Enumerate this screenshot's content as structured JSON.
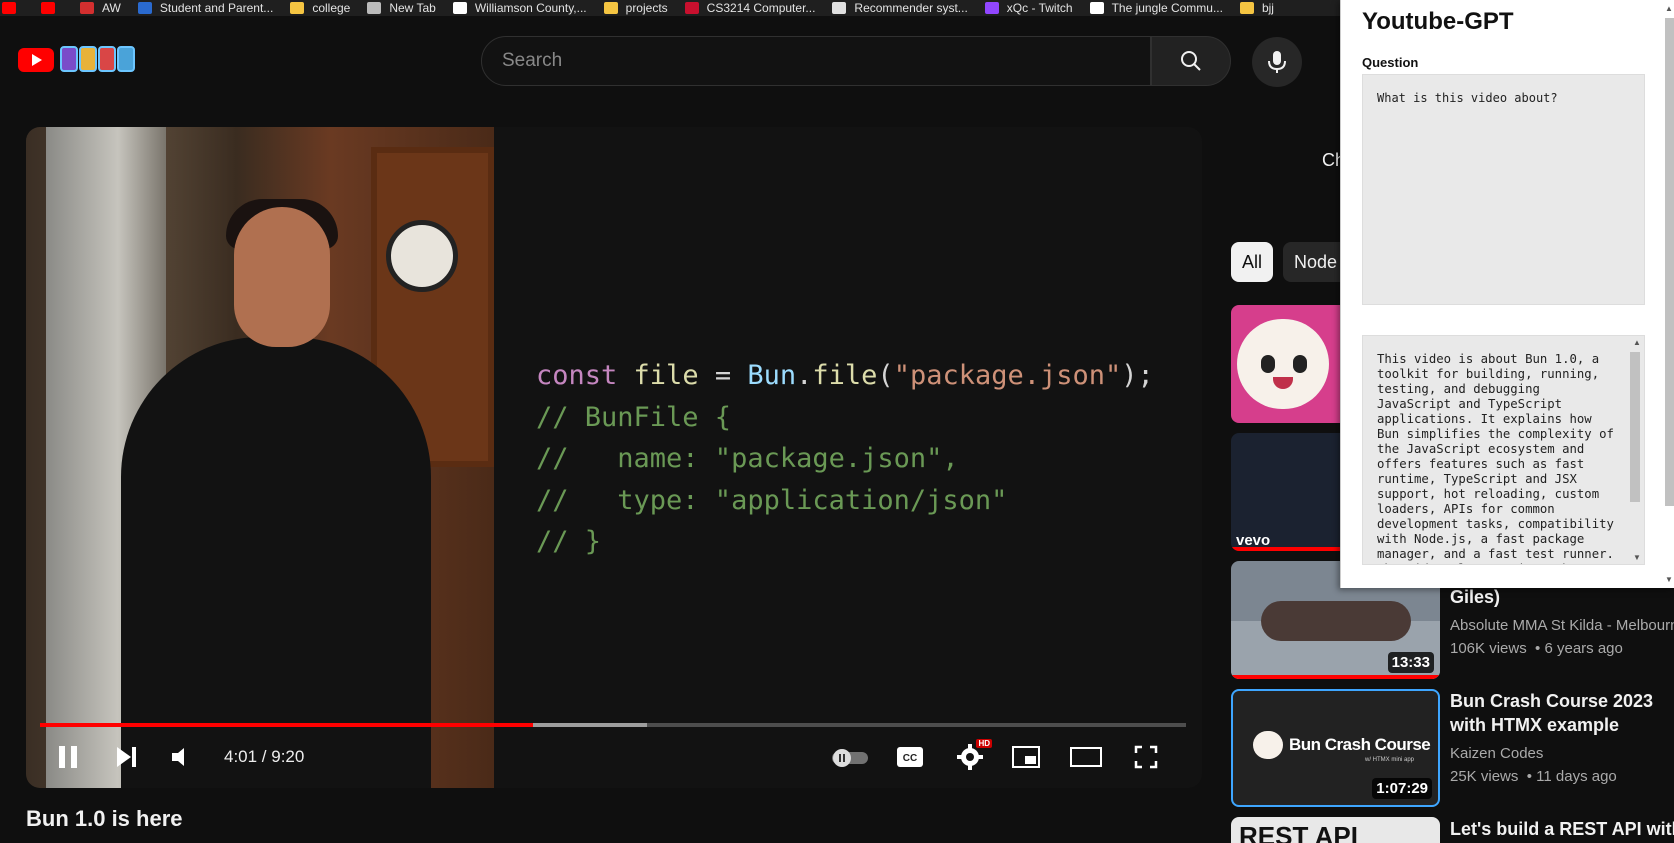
{
  "bookmarks": [
    {
      "label": "",
      "icon": "youtube-icon",
      "color": "#ff0000"
    },
    {
      "label": "",
      "icon": "youtube-icon",
      "color": "#ff0000"
    },
    {
      "label": "AW",
      "icon": "aw-icon",
      "color": "#d32f2f"
    },
    {
      "label": "Student and Parent...",
      "icon": "school-icon",
      "color": "#2a6acf"
    },
    {
      "label": "college",
      "icon": "folder-icon",
      "color": "#f5c542"
    },
    {
      "label": "New Tab",
      "icon": "globe-icon",
      "color": "#bbbbbb"
    },
    {
      "label": "Williamson County,...",
      "icon": "page-icon",
      "color": "#ffffff"
    },
    {
      "label": "projects",
      "icon": "folder-icon",
      "color": "#f5c542"
    },
    {
      "label": "CS3214 Computer...",
      "icon": "vt-icon",
      "color": "#c8102e"
    },
    {
      "label": "Recommender syst...",
      "icon": "sn-icon",
      "color": "#e0e0e0"
    },
    {
      "label": "xQc - Twitch",
      "icon": "twitch-icon",
      "color": "#9146ff"
    },
    {
      "label": "The jungle Commu...",
      "icon": "x-icon",
      "color": "#ffffff"
    },
    {
      "label": "bjj",
      "icon": "folder-icon",
      "color": "#f5c542"
    }
  ],
  "search": {
    "placeholder": "Search"
  },
  "player": {
    "time": "4:01 / 9:20",
    "progress_fraction": 0.43,
    "buffered_fraction": 0.53,
    "hd_badge": "HD",
    "code_lines": [
      "const file = Bun.file(\"package.json\");",
      "// BunFile {",
      "//   name: \"package.json\",",
      "//   type: \"application/json\"",
      "// }"
    ]
  },
  "video_title": "Bun 1.0 is here",
  "sidebar": {
    "ch_partial": "Ch",
    "chips": [
      "All",
      "Node"
    ],
    "videos": [
      {
        "title": "",
        "channel": "",
        "views": "",
        "age": "",
        "duration": "",
        "thumb_color": "#d63e8c"
      },
      {
        "title": "",
        "channel": "",
        "views": "",
        "age": "",
        "duration": "",
        "thumb_color": "#1b2230",
        "badge": "vevo"
      },
      {
        "title": "Giles)",
        "channel": "Absolute MMA St Kilda - Melbourne",
        "views": "106K views",
        "age": "6 years ago",
        "duration": "13:33",
        "thumb_color": "#7c8691"
      },
      {
        "title": "Bun Crash Course 2023 with HTMX example",
        "channel": "Kaizen Codes",
        "views": "25K views",
        "age": "11 days ago",
        "duration": "1:07:29",
        "thumb_color": "#222222",
        "thumb_text": "Bun Crash Course",
        "thumb_sub": "w/ HTMX mini app"
      },
      {
        "title": "Let's build a REST API with B",
        "channel": "",
        "views": "",
        "age": "",
        "duration": "",
        "thumb_color": "#e8e8e8",
        "thumb_text": "REST API"
      }
    ]
  },
  "extension": {
    "title": "Youtube-GPT",
    "question_label": "Question",
    "question": "What is this video about?",
    "answer": "This video is about Bun 1.0, a toolkit for building, running, testing, and debugging JavaScript and TypeScript applications. It explains how Bun simplifies the complexity of the JavaScript ecosystem and offers features such as fast runtime, TypeScript and JSX support, hot reloading, custom loaders, APIs for common development tasks, compatibility with Node.js, a fast package manager, and a fast test runner. The video also mentions the"
  }
}
